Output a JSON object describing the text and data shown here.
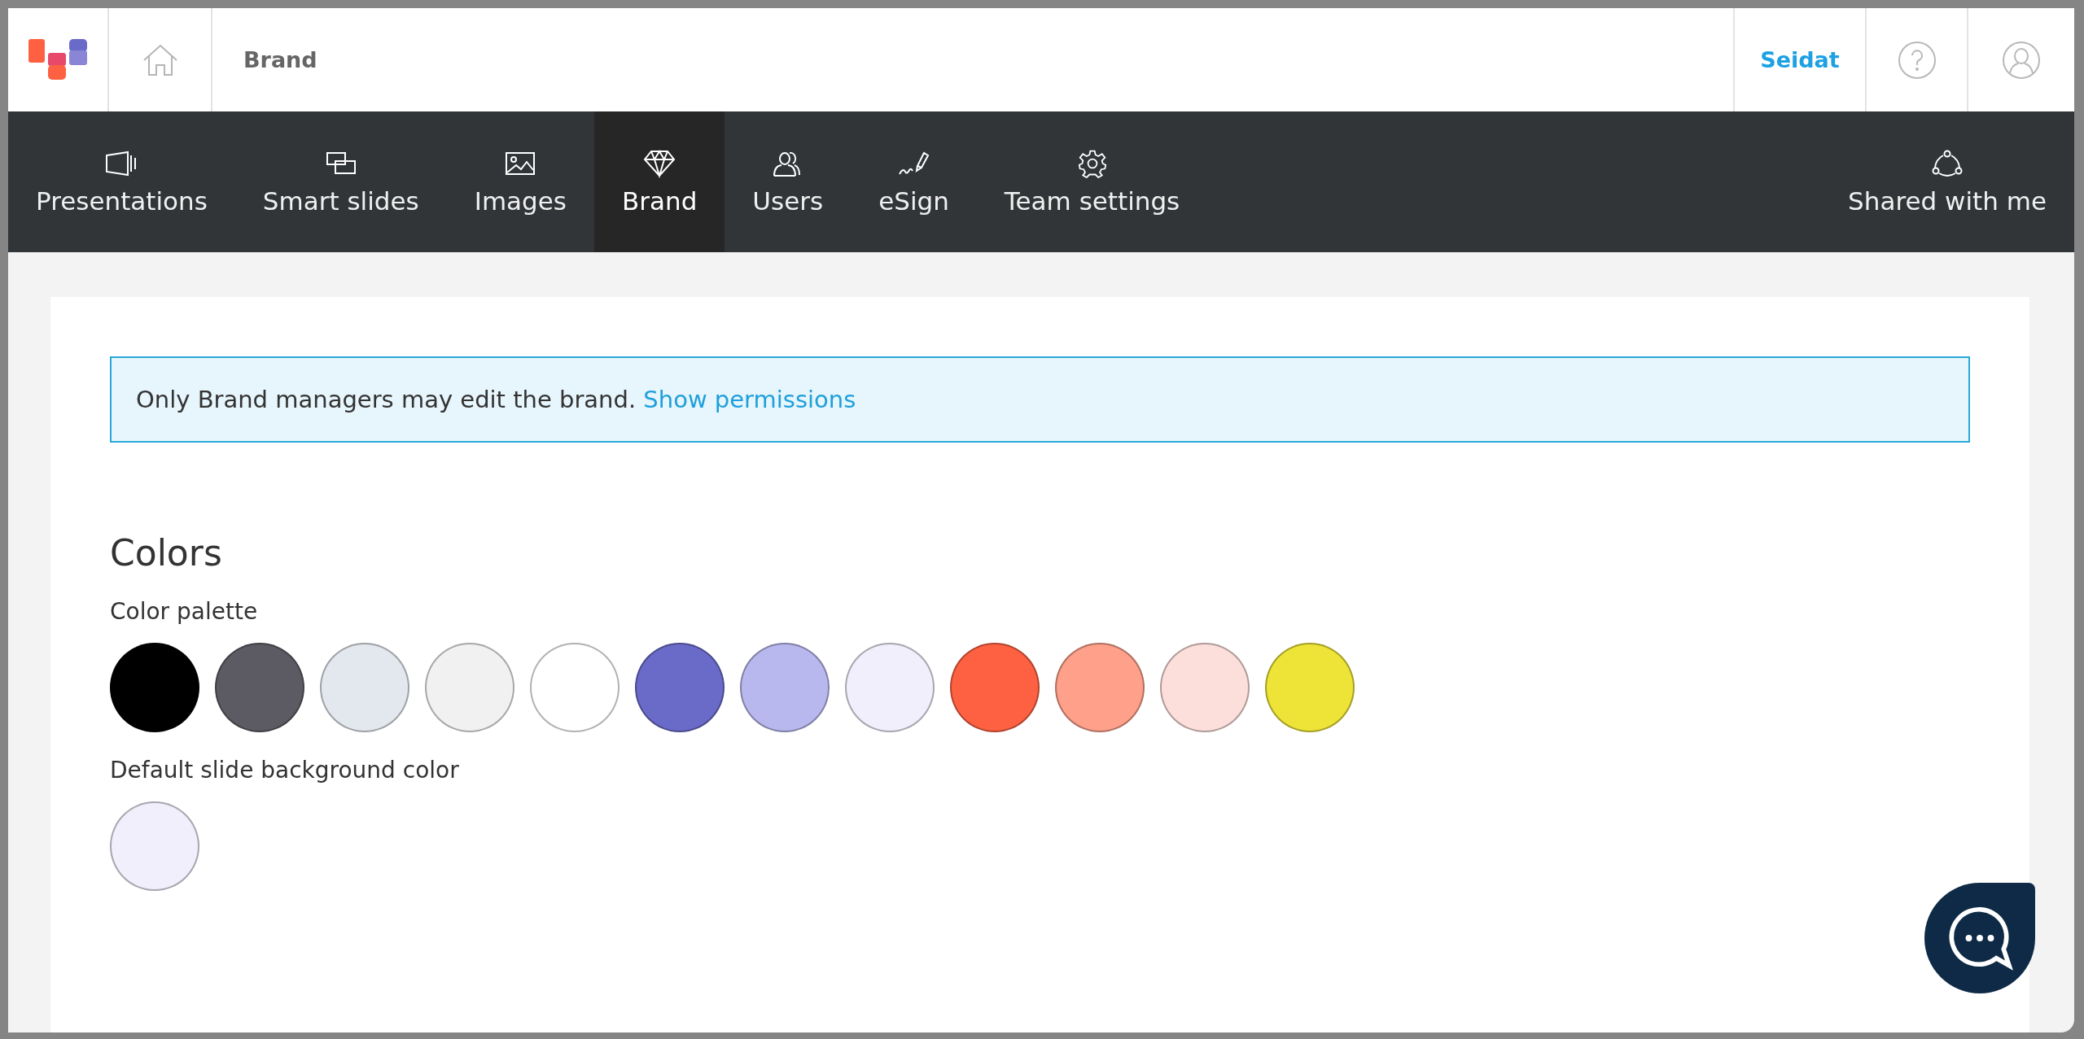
{
  "header": {
    "title": "Brand",
    "user_link": "Seidat"
  },
  "nav": {
    "tabs": [
      {
        "label": "Presentations",
        "selected": false
      },
      {
        "label": "Smart slides",
        "selected": false
      },
      {
        "label": "Images",
        "selected": false
      },
      {
        "label": "Brand",
        "selected": true
      },
      {
        "label": "Users",
        "selected": false
      },
      {
        "label": "eSign",
        "selected": false
      },
      {
        "label": "Team settings",
        "selected": false
      }
    ],
    "right_tab": {
      "label": "Shared with me",
      "selected": false
    }
  },
  "notice": {
    "text": "Only Brand managers may edit the brand.",
    "link": "Show permissions"
  },
  "colors": {
    "heading": "Colors",
    "palette_label": "Color palette",
    "palette": [
      {
        "color": "#000000"
      },
      {
        "color": "#5c5b63"
      },
      {
        "color": "#e3e8ee"
      },
      {
        "color": "#f1f1f1"
      },
      {
        "color": "#ffffff"
      },
      {
        "color": "#6a6bc9"
      },
      {
        "color": "#b8b8ee"
      },
      {
        "color": "#f0effb"
      },
      {
        "color": "#fe6142"
      },
      {
        "color": "#fea08a"
      },
      {
        "color": "#fcdfdb"
      },
      {
        "color": "#ede437"
      }
    ],
    "default_label": "Default slide background color",
    "default": {
      "color": "#f0effb"
    }
  }
}
